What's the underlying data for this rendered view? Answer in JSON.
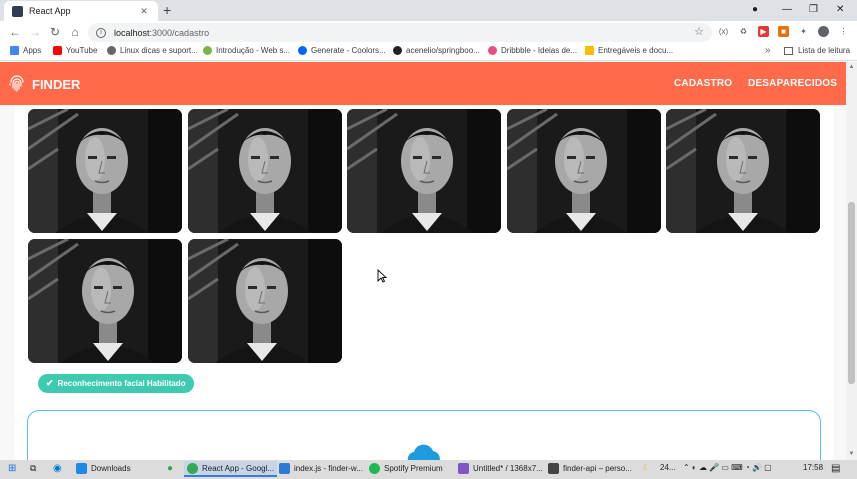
{
  "browser": {
    "tab_title": "React App",
    "url_host": "localhost",
    "url_path": ":3000/cadastro",
    "bookmarks": [
      {
        "label": "Apps",
        "color": "#4285f4"
      },
      {
        "label": "YouTube",
        "color": "#ff0000"
      },
      {
        "label": "Linux dicas e suport...",
        "color": "#666666"
      },
      {
        "label": "Introdução - Web s...",
        "color": "#7cb342"
      },
      {
        "label": "Generate - Coolors...",
        "color": "#0066ff"
      },
      {
        "label": "acenelio/springboo...",
        "color": "#222222"
      },
      {
        "label": "Dribbble - Ideias de...",
        "color": "#ea4c89"
      },
      {
        "label": "Entregáveis e docu...",
        "color": "#fbbc04"
      }
    ],
    "reading_list": "Lista de leitura",
    "more": "»"
  },
  "app": {
    "brand": "FINDER",
    "nav": [
      "CADASTRO",
      "DESAPARECIDOS"
    ],
    "accent": "#ff6b4a",
    "face_recognition_label": "Reconhecimento facial Habilitado",
    "badge_color": "#3ec9b1",
    "upload_border_color": "#4fc3e0",
    "photos_count": 7
  },
  "taskbar": {
    "items": [
      {
        "label": "Downloads",
        "color": "#1e88e5"
      },
      {
        "label": "React App - Googl...",
        "color": "#34a853"
      },
      {
        "label": "index.js - finder-w...",
        "color": "#2b7bd6"
      },
      {
        "label": "Spotify Premium",
        "color": "#1db954"
      },
      {
        "label": "Untitled* / 1368x7...",
        "color": "#7e57c2"
      },
      {
        "label": "finder-api – perso...",
        "color": "#444444"
      }
    ],
    "weather": "24...",
    "clock": "17:58"
  }
}
